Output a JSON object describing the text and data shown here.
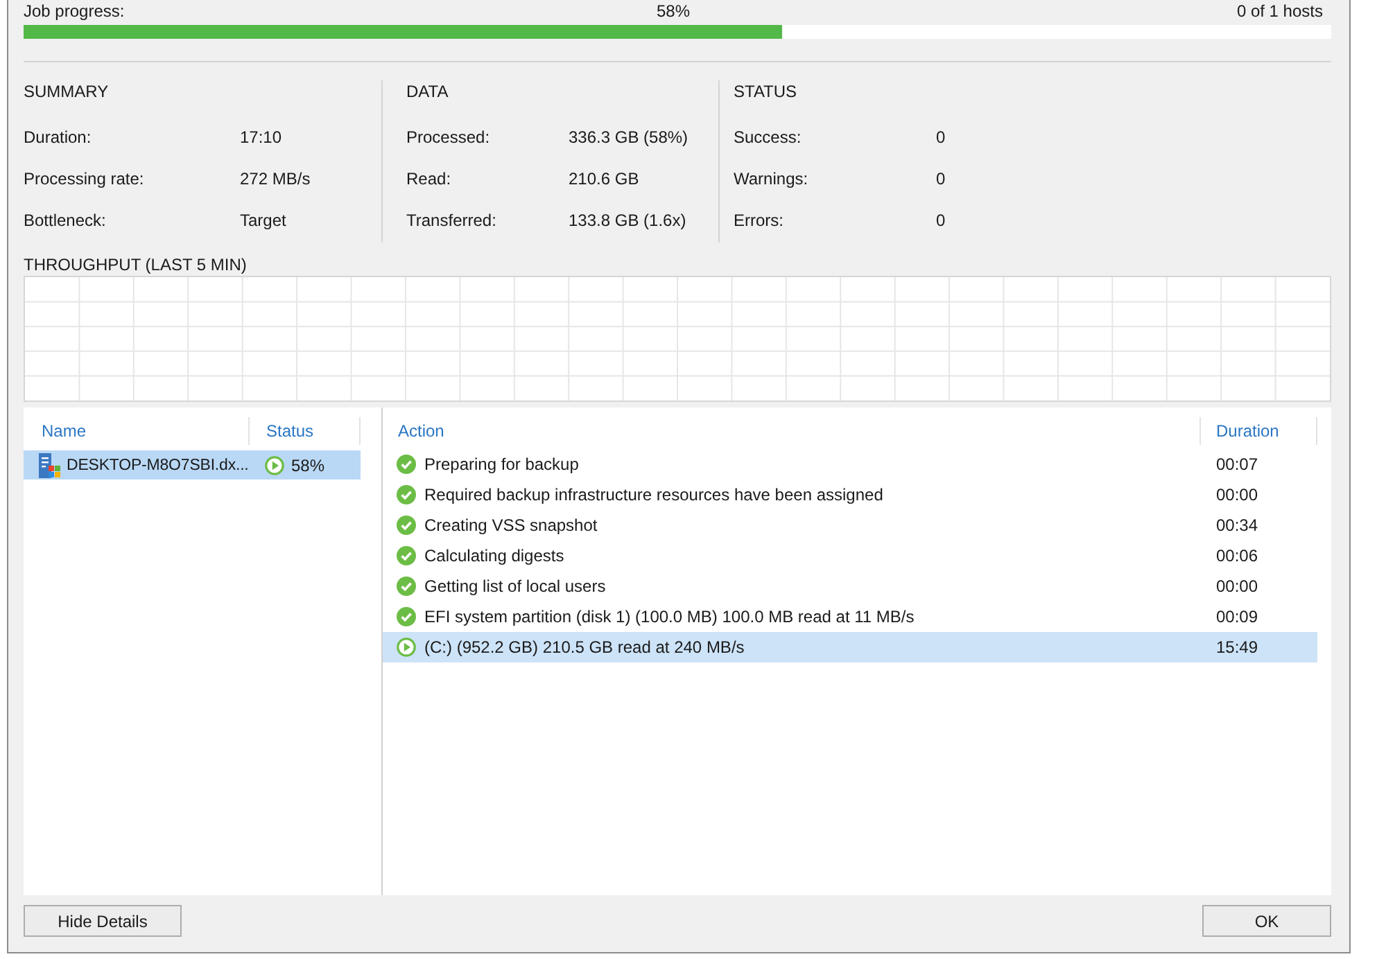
{
  "job_progress": {
    "label": "Job progress:",
    "percent": "58%",
    "hosts": "0 of 1 hosts",
    "level": 0.58
  },
  "sections": [
    {
      "title": "SUMMARY",
      "rows": [
        {
          "label": "Duration:",
          "value": "17:10"
        },
        {
          "label": "Processing rate:",
          "value": "272 MB/s"
        },
        {
          "label": "Bottleneck:",
          "value": "Target"
        }
      ]
    },
    {
      "title": "DATA",
      "rows": [
        {
          "label": "Processed:",
          "value": "336.3 GB (58%)"
        },
        {
          "label": "Read:",
          "value": "210.6 GB"
        },
        {
          "label": "Transferred:",
          "value": "133.8 GB (1.6x)"
        }
      ]
    },
    {
      "title": "STATUS",
      "rows": [
        {
          "label": "Success:",
          "value": "0"
        },
        {
          "label": "Warnings:",
          "value": "0"
        },
        {
          "label": "Errors:",
          "value": "0"
        }
      ]
    }
  ],
  "throughput": {
    "title": "THROUGHPUT (LAST 5 MIN)"
  },
  "hosts_table": {
    "columns": [
      "Name",
      "Status"
    ],
    "rows": [
      {
        "name": "DESKTOP-M8O7SBI.dx...",
        "status": "58%",
        "kind": "running",
        "selected": true
      }
    ]
  },
  "actions_table": {
    "columns": [
      "Action",
      "Duration"
    ],
    "rows": [
      {
        "action": "Preparing for backup",
        "duration": "00:07",
        "kind": "done",
        "selected": false
      },
      {
        "action": "Required backup infrastructure resources have been assigned",
        "duration": "00:00",
        "kind": "done",
        "selected": false
      },
      {
        "action": "Creating VSS snapshot",
        "duration": "00:34",
        "kind": "done",
        "selected": false
      },
      {
        "action": "Calculating digests",
        "duration": "00:06",
        "kind": "done",
        "selected": false
      },
      {
        "action": "Getting list of local users",
        "duration": "00:00",
        "kind": "done",
        "selected": false
      },
      {
        "action": "EFI system partition (disk 1) (100.0 MB) 100.0 MB read at 11 MB/s",
        "duration": "00:09",
        "kind": "done",
        "selected": false
      },
      {
        "action": "(C:) (952.2 GB) 210.5 GB read at 240 MB/s",
        "duration": "15:49",
        "kind": "running",
        "selected": true
      }
    ]
  },
  "buttons": [
    {
      "label": "Hide Details"
    },
    {
      "label": "OK"
    }
  ]
}
